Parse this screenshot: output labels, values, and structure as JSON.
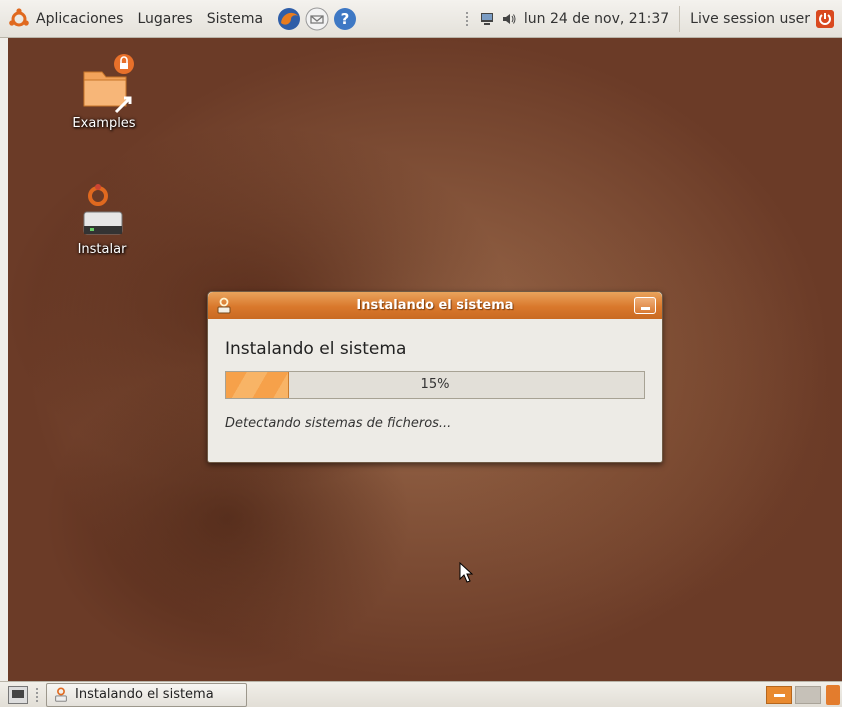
{
  "top_panel": {
    "menus": [
      "Aplicaciones",
      "Lugares",
      "Sistema"
    ],
    "launchers": [
      "firefox-icon",
      "mail-icon",
      "help-icon"
    ],
    "clock": "lun 24 de nov, 21:37",
    "user": "Live session user"
  },
  "desktop": {
    "icons": [
      {
        "label": "Examples",
        "icon": "folder-icon"
      },
      {
        "label": "Instalar",
        "icon": "installer-icon"
      }
    ]
  },
  "dialog": {
    "title": "Instalando el sistema",
    "heading": "Instalando el sistema",
    "progress_percent": 15,
    "progress_label": "15%",
    "status": "Detectando sistemas de ficheros..."
  },
  "bottom_panel": {
    "task_label": "Instalando el sistema"
  },
  "colors": {
    "accent": "#d9782c",
    "progress": "#f6a14a"
  }
}
